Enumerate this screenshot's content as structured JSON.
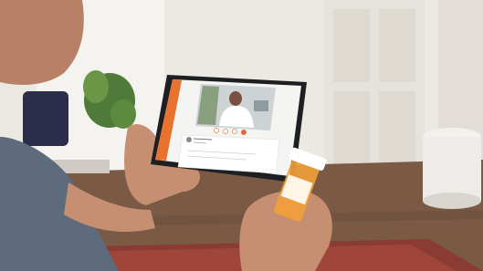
{
  "scene": {
    "description_colors": {
      "wall": "#ece9e3",
      "floor": "#7a5a45",
      "tablet_frame": "#1e1f22",
      "screen_bg": "#f4f4f2",
      "accent_bar": "#e8722e",
      "bottle": "#f2a03a",
      "shirt": "#5d6b7c",
      "skin": "#c68f72"
    }
  },
  "video_call": {
    "controls": [
      "camera",
      "mute",
      "chat",
      "end-call"
    ]
  }
}
